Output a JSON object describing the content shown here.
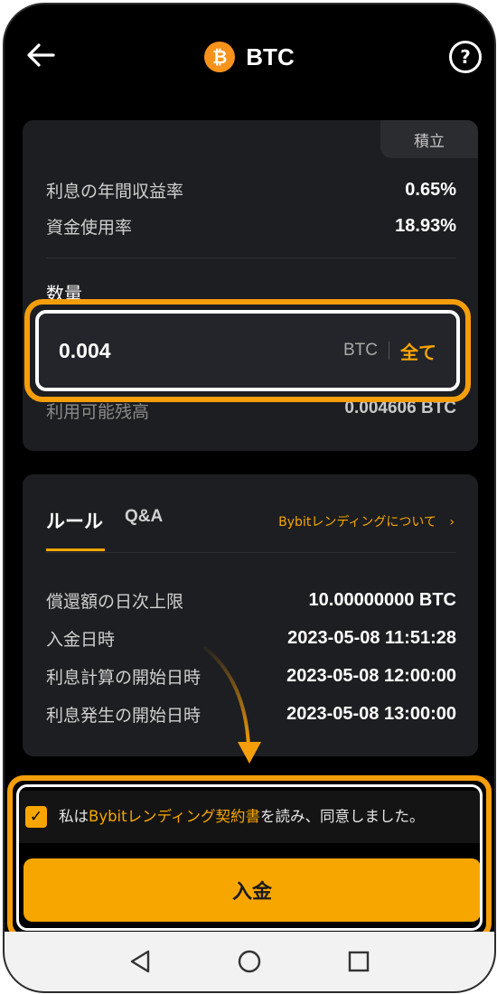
{
  "header": {
    "title": "BTC",
    "coin_symbol": "₿"
  },
  "summary": {
    "tag": "積立",
    "rows": [
      {
        "label": "利息の年間収益率",
        "value": "0.65%"
      },
      {
        "label": "資金使用率",
        "value": "18.93%"
      }
    ],
    "quantity_label": "数量",
    "input": {
      "value": "0.004",
      "unit": "BTC",
      "all_label": "全て"
    },
    "available": {
      "label": "利用可能残高",
      "value": "0.004606 BTC"
    }
  },
  "info": {
    "tabs": [
      {
        "label": "ルール"
      },
      {
        "label": "Q&A"
      }
    ],
    "about_link": "Bybitレンディングについて",
    "rows": [
      {
        "label": "償還額の日次上限",
        "value": "10.00000000 BTC"
      },
      {
        "label": "入金日時",
        "value": "2023-05-08 11:51:28"
      },
      {
        "label": "利息計算の開始日時",
        "value": "2023-05-08 12:00:00"
      },
      {
        "label": "利息発生の開始日時",
        "value": "2023-05-08 13:00:00"
      }
    ]
  },
  "agreement": {
    "prefix": "私は",
    "link": "Bybitレンディング契約書",
    "suffix": "を読み、同意しました。",
    "checked": true
  },
  "deposit_button": "入金",
  "colors": {
    "accent": "#f7a600",
    "highlight": "#f59e0b"
  }
}
